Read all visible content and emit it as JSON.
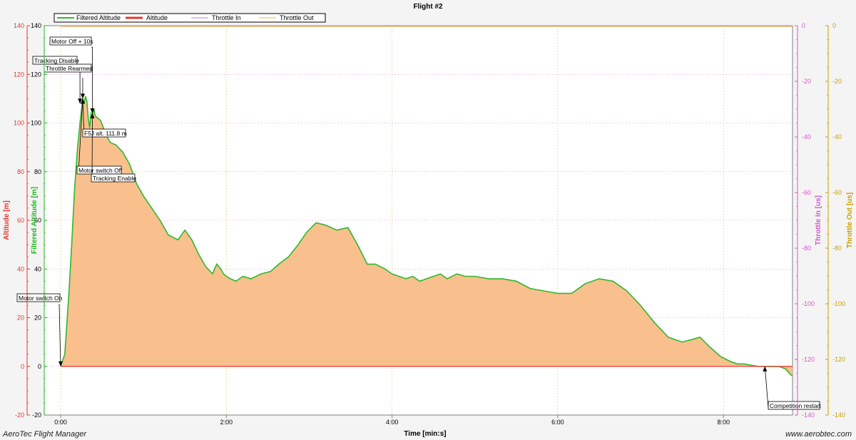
{
  "footer": {
    "brand": "AeroTec Flight Manager",
    "url": "www.aerobtec.com"
  },
  "chart_data": {
    "type": "area",
    "title": "Flight #2",
    "xlabel": "Time [min:s]",
    "xlim": [
      0,
      530
    ],
    "xticks": [
      0,
      120,
      240,
      360,
      480
    ],
    "xtick_labels": [
      "0:00",
      "2:00",
      "4:00",
      "6:00",
      "8:00"
    ],
    "grid": true,
    "legend_position": "top-left",
    "axes": {
      "altitude": {
        "label": "Altitude [m]",
        "range": [
          -20,
          140
        ],
        "ticks": [
          -20,
          0,
          20,
          40,
          60,
          80,
          100,
          120,
          140
        ],
        "color": "#e8352e"
      },
      "filtered_altitude": {
        "label": "Filtered Altitude [m]",
        "range": [
          -20,
          140
        ],
        "ticks": [
          -20,
          0,
          20,
          40,
          60,
          80,
          100,
          120,
          140
        ],
        "color": "#22b322"
      },
      "throttle_in": {
        "label": "Throttle In [us]",
        "range": [
          -140,
          0
        ],
        "ticks": [
          0,
          -20,
          -40,
          -60,
          -80,
          -100,
          -120,
          -140
        ],
        "color": "#d35ac8"
      },
      "throttle_out": {
        "label": "Throttle Out [us]",
        "range": [
          -140,
          0
        ],
        "ticks": [
          0,
          -20,
          -40,
          -60,
          -80,
          -100,
          -120,
          -140
        ],
        "color": "#c9a000"
      }
    },
    "series": [
      {
        "name": "Filtered Altitude",
        "color": "#2eb82e",
        "fill": "#f9c08d",
        "x": [
          0,
          3,
          6,
          8,
          10,
          12,
          14,
          16,
          17,
          18,
          19,
          20,
          21,
          22,
          23,
          24,
          25,
          27,
          29,
          31,
          33,
          36,
          40,
          45,
          50,
          55,
          60,
          66,
          72,
          78,
          85,
          90,
          95,
          100,
          105,
          110,
          113,
          116,
          118,
          120,
          123,
          127,
          132,
          138,
          145,
          152,
          158,
          165,
          172,
          178,
          185,
          192,
          200,
          208,
          215,
          222,
          228,
          235,
          240,
          245,
          250,
          255,
          260,
          265,
          270,
          275,
          280,
          287,
          293,
          300,
          310,
          320,
          330,
          340,
          350,
          360,
          370,
          380,
          390,
          400,
          410,
          420,
          430,
          440,
          450,
          457,
          463,
          470,
          478,
          485,
          490,
          495,
          500,
          505,
          510,
          515,
          520,
          525,
          528,
          530
        ],
        "values": [
          0,
          5,
          30,
          50,
          72,
          88,
          100,
          110,
          108,
          111,
          109,
          102,
          98,
          104,
          103,
          106,
          103,
          102,
          101,
          98,
          95,
          92,
          91,
          88,
          83,
          75,
          70,
          65,
          60,
          54,
          52,
          56,
          52,
          46,
          41,
          38,
          42,
          40,
          38,
          37,
          36,
          35,
          37,
          36,
          38,
          39,
          42,
          45,
          50,
          55,
          59,
          58,
          56,
          57,
          50,
          42,
          42,
          40,
          38,
          37,
          36,
          37,
          35,
          36,
          37,
          38,
          36,
          38,
          37,
          37,
          36,
          36,
          35,
          32,
          31,
          30,
          30,
          34,
          36,
          35,
          31,
          25,
          18,
          12,
          10,
          11,
          12,
          8,
          4,
          2,
          1,
          1,
          0.5,
          0,
          0,
          0,
          0,
          -1,
          -3,
          -4
        ]
      },
      {
        "name": "Altitude",
        "color": "#e8352e",
        "constant": 0
      },
      {
        "name": "Throttle In",
        "color": "#b678e8",
        "constant": 0
      },
      {
        "name": "Throttle Out",
        "color": "#e6b84d",
        "constant": 0
      }
    ],
    "annotations": [
      {
        "label": "Motor switch On",
        "x": 0,
        "y": 0
      },
      {
        "label": "Motor Off + 10s",
        "x": 23,
        "y": 105
      },
      {
        "label": "Tracking Disable",
        "x": 14,
        "y": 108
      },
      {
        "label": "Throttle Rearmed",
        "x": 16,
        "y": 110
      },
      {
        "label": "F5J alt. 111.8 m",
        "x": 16,
        "y": 110
      },
      {
        "label": "Motor switch Off",
        "x": 16,
        "y": 110
      },
      {
        "label": "Tracking Enable",
        "x": 23,
        "y": 104
      },
      {
        "label": "Competition restart",
        "x": 510,
        "y": 0
      }
    ]
  }
}
